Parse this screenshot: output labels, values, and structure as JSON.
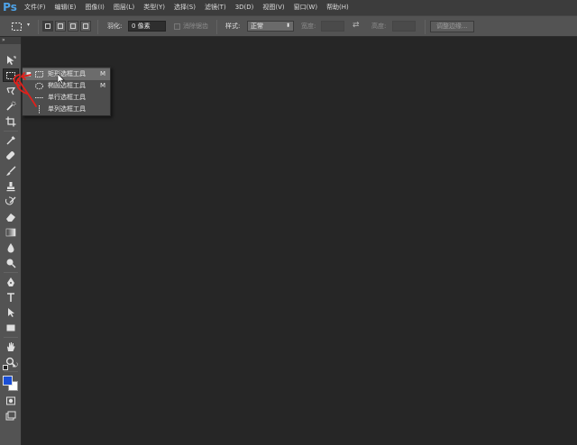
{
  "app": {
    "logo": "Ps"
  },
  "menubar": {
    "items": [
      "文件(F)",
      "编辑(E)",
      "图像(I)",
      "图层(L)",
      "类型(Y)",
      "选择(S)",
      "滤镜(T)",
      "3D(D)",
      "视图(V)",
      "窗口(W)",
      "帮助(H)"
    ]
  },
  "options": {
    "feather_label": "羽化:",
    "feather_value": "0 像素",
    "antialias_label": "消除锯齿",
    "style_label": "样式:",
    "style_value": "正常",
    "width_label": "宽度:",
    "height_label": "高度:",
    "refine_edge_label": "调整边缘..."
  },
  "toolbar": {
    "collapse_glyph": "»",
    "foreground_color": "#1a4fd6",
    "background_color": "#ffffff",
    "tools": [
      "move-tool",
      "marquee-tool",
      "lasso-tool",
      "quick-selection-tool",
      "crop-tool",
      "eyedropper-tool",
      "healing-brush-tool",
      "brush-tool",
      "clone-stamp-tool",
      "history-brush-tool",
      "eraser-tool",
      "gradient-tool",
      "blur-tool",
      "dodge-tool",
      "pen-tool",
      "type-tool",
      "path-selection-tool",
      "rectangle-tool",
      "hand-tool",
      "zoom-tool",
      "quick-mask",
      "screen-mode"
    ]
  },
  "flyout": {
    "items": [
      {
        "label": "矩形选框工具",
        "shortcut": "M",
        "selected": true,
        "icon": "rect-marquee-icon"
      },
      {
        "label": "椭圆选框工具",
        "shortcut": "M",
        "selected": false,
        "icon": "ellipse-marquee-icon"
      },
      {
        "label": "单行选框工具",
        "shortcut": "",
        "selected": false,
        "icon": "single-row-marquee-icon"
      },
      {
        "label": "单列选框工具",
        "shortcut": "",
        "selected": false,
        "icon": "single-column-marquee-icon"
      }
    ]
  },
  "annotation": {
    "color": "#e0201b"
  }
}
